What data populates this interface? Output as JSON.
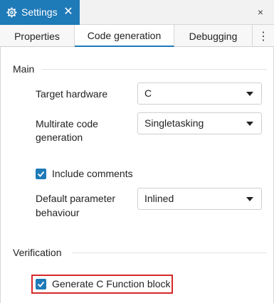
{
  "window": {
    "title": "Settings",
    "tab_close": "✕",
    "close": "×"
  },
  "tabs": [
    {
      "label": "Properties",
      "active": false
    },
    {
      "label": "Code generation",
      "active": true
    },
    {
      "label": "Debugging",
      "active": false
    }
  ],
  "tabs_more": "⋮",
  "sections": {
    "main": {
      "title": "Main",
      "target_hardware": {
        "label": "Target hardware",
        "value": "C"
      },
      "multirate": {
        "label_line1": "Multirate code",
        "label_line2": "generation",
        "value": "Singletasking"
      },
      "include_comments": {
        "label": "Include comments",
        "checked": true
      },
      "default_param": {
        "label_line1": "Default parameter",
        "label_line2": "behaviour",
        "value": "Inlined"
      }
    },
    "verification": {
      "title": "Verification",
      "generate_c_function_block": {
        "label": "Generate C Function block",
        "checked": true
      }
    }
  },
  "colors": {
    "accent": "#1f7ab8",
    "highlight": "#d62828"
  }
}
